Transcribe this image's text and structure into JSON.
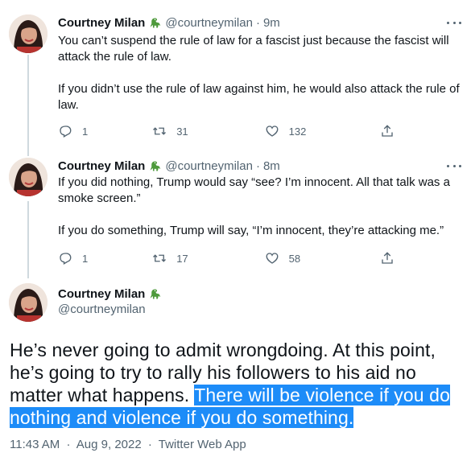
{
  "author": {
    "name": "Courtney Milan",
    "handle": "@courtneymilan",
    "emoji": "dinosaur"
  },
  "tweets": [
    {
      "time": "9m",
      "paragraphs": [
        "You can’t suspend the rule of law for a fascist just because the fascist will attack the rule of law.",
        "If you didn’t use the rule of law against him, he would also attack the rule of law."
      ],
      "replies": "1",
      "retweets": "31",
      "likes": "132"
    },
    {
      "time": "8m",
      "paragraphs": [
        "If you did nothing, Trump would say “see? I’m innocent. All that talk was a smoke screen.”",
        "If you do something, Trump will say, “I’m innocent, they’re attacking me.”"
      ],
      "replies": "1",
      "retweets": "17",
      "likes": "58"
    }
  ],
  "main_tweet": {
    "text_plain": "He’s never going to admit wrongdoing. At this point, he’s going to try to rally his followers to his aid no matter what happens. ",
    "text_highlighted": "There will be violence if you do nothing and violence if you do something.",
    "time": "11:43 AM",
    "date": "Aug 9, 2022",
    "source": "Twitter Web App"
  },
  "separator": "·",
  "colors": {
    "text": "#0f1419",
    "secondary": "#536471",
    "highlight": "#1d8cf8",
    "thread_line": "#cfd9de"
  },
  "icons": [
    "reply-icon",
    "retweet-icon",
    "like-icon",
    "share-icon",
    "more-icon",
    "dinosaur-icon"
  ]
}
